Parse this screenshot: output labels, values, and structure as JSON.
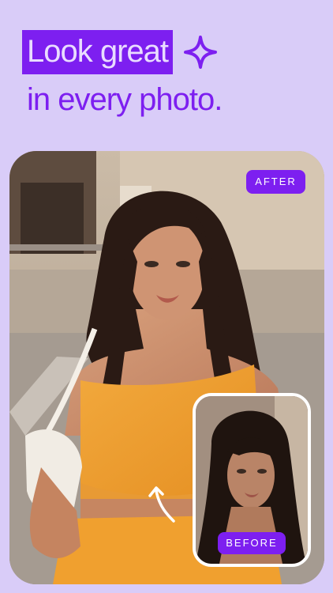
{
  "headline": {
    "highlight": "Look great",
    "line2": "in every photo."
  },
  "icons": {
    "sparkle": "sparkle-icon",
    "arrow": "curved-arrow-icon"
  },
  "labels": {
    "after": "AFTER",
    "before": "BEFORE"
  },
  "colors": {
    "background": "#d9ccf8",
    "accent": "#7d1ff0",
    "highlight_text": "#e9dcff"
  }
}
